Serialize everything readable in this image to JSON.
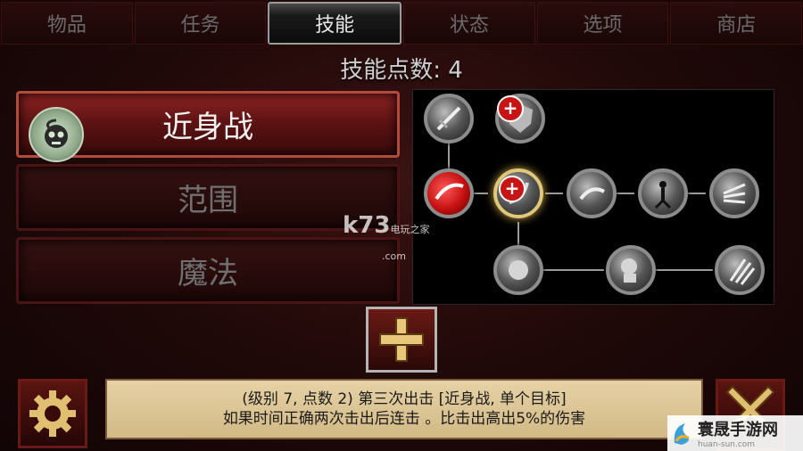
{
  "tabs": [
    {
      "label": "物品",
      "active": false
    },
    {
      "label": "任务",
      "active": false
    },
    {
      "label": "技能",
      "active": true
    },
    {
      "label": "状态",
      "active": false
    },
    {
      "label": "选项",
      "active": false
    },
    {
      "label": "商店",
      "active": false
    }
  ],
  "skill_points_label": "技能点数: 4",
  "categories": [
    {
      "label": "近身战",
      "active": true,
      "icon": "skull-icon"
    },
    {
      "label": "范围",
      "active": false
    },
    {
      "label": "魔法",
      "active": false
    }
  ],
  "skill_tree": {
    "nodes": [
      {
        "name": "sword-skill-icon",
        "state": "learned"
      },
      {
        "name": "shield-upgrade-icon",
        "state": "upgradable"
      },
      {
        "name": "slash-skill-icon",
        "state": "learned"
      },
      {
        "name": "combo-strike-icon",
        "state": "selected-upgradable"
      },
      {
        "name": "cleave-skill-icon",
        "state": "locked"
      },
      {
        "name": "stance-skill-icon",
        "state": "locked"
      },
      {
        "name": "whirl-skill-icon",
        "state": "locked"
      },
      {
        "name": "fist-skill-icon",
        "state": "locked"
      },
      {
        "name": "rage-skill-icon",
        "state": "locked"
      },
      {
        "name": "claw-skill-icon",
        "state": "locked"
      }
    ]
  },
  "description": {
    "line1": "(级别 7, 点数 2) 第三次出击 [近身战, 单个目标]",
    "line2": "如果时间正确两次击出后连击 。比击出高出5%的伤害"
  },
  "watermark": {
    "text": "k73",
    "sub": "电玩之家",
    "domain": ".com"
  },
  "site_logo": {
    "name": "寰晟手游网",
    "url": "huan-sun.com"
  },
  "colors": {
    "accent_red": "#c81414",
    "selected_gold": "#e0c77a",
    "parchment": "#e6d2a6"
  }
}
